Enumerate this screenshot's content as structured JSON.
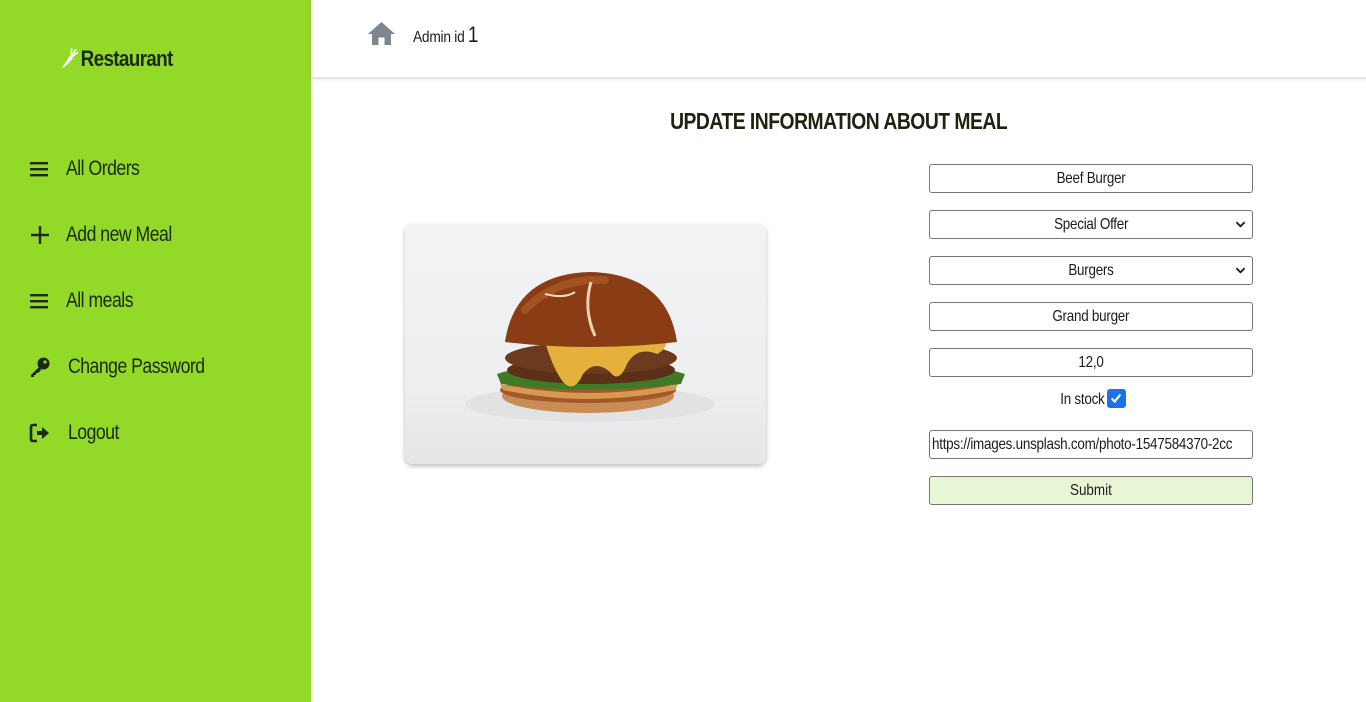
{
  "sidebar": {
    "brand": "Restaurant",
    "items": [
      {
        "label": "All Orders",
        "icon": "menu-icon"
      },
      {
        "label": "Add new Meal",
        "icon": "plus-icon"
      },
      {
        "label": "All meals",
        "icon": "menu-icon"
      },
      {
        "label": "Change Password",
        "icon": "key-icon"
      },
      {
        "label": "Logout",
        "icon": "logout-icon"
      }
    ]
  },
  "header": {
    "admin_label": "Admin id",
    "admin_id": "1"
  },
  "main": {
    "title": "UPDATE INFORMATION ABOUT MEAL",
    "form": {
      "name": "Beef Burger",
      "offer": "Special Offer",
      "category": "Burgers",
      "description": "Grand burger",
      "price": "12,0",
      "in_stock_label": "In stock",
      "in_stock": true,
      "image_url": "https://images.unsplash.com/photo-1547584370-2cc",
      "submit": "Submit"
    }
  },
  "colors": {
    "sidebar": "#93d928",
    "submit_bg": "#e8f6d5",
    "checkbox": "#1a73e8"
  }
}
